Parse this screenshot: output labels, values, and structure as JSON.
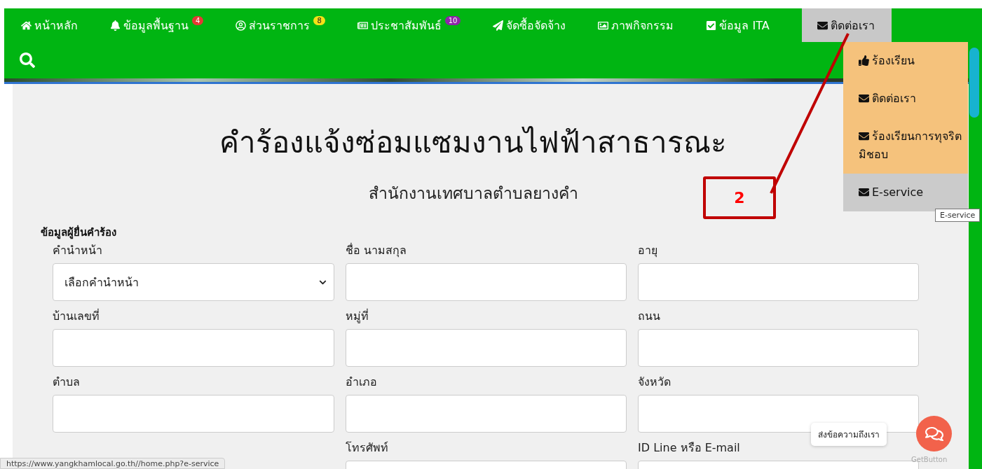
{
  "nav": {
    "items": [
      {
        "label": "หน้าหลัก",
        "expanded": false
      },
      {
        "label": "ข้อมูลพื้นฐาน",
        "expanded": false,
        "badge": {
          "text": "4",
          "color": "#e53935"
        }
      },
      {
        "label": "ส่วนราชการ",
        "expanded": false,
        "badge": {
          "text": "8",
          "color": "#f7e017"
        }
      },
      {
        "label": "ประชาสัมพันธ์",
        "expanded": false,
        "badge": {
          "text": "10",
          "color": "#8e24aa"
        }
      },
      {
        "label": "จัดซื้อจัดจ้าง",
        "expanded": false
      },
      {
        "label": "ภาพกิจกรรม",
        "expanded": false
      },
      {
        "label": "ข้อมูล ITA",
        "expanded": false
      },
      {
        "label": "ติดต่อเรา",
        "expanded": true
      }
    ]
  },
  "dropdown": {
    "items": [
      {
        "label": "ร้องเรียน",
        "selected": false
      },
      {
        "label": "ติดต่อเรา",
        "selected": false
      },
      {
        "label": "ร้องเรียนการทุจริต มิชอบ",
        "selected": false
      },
      {
        "label": "E-service",
        "selected": true
      }
    ],
    "tooltip": "E-service"
  },
  "form": {
    "title": "คำร้องแจ้งซ่อมแซมงานไฟฟ้าสาธารณะ",
    "subtitle": "สำนักงานเทศบาลตำบลยางคำ",
    "section": "ข้อมูลผู้ยื่นคำร้อง",
    "fields": [
      {
        "label": "คำนำหน้า",
        "kind": "select",
        "value": "เลือกคำนำหน้า"
      },
      {
        "label": "ชื่อ นามสกุล",
        "kind": "text"
      },
      {
        "label": "อายุ",
        "kind": "text"
      },
      {
        "label": "บ้านเลขที่",
        "kind": "text"
      },
      {
        "label": "หมู่ที่",
        "kind": "text"
      },
      {
        "label": "ถนน",
        "kind": "text"
      },
      {
        "label": "ตำบล",
        "kind": "text"
      },
      {
        "label": "อำเภอ",
        "kind": "text"
      },
      {
        "label": "จังหวัด",
        "kind": "text"
      },
      {
        "kind": "hidden"
      },
      {
        "label": "โทรศัพท์",
        "kind": "text"
      },
      {
        "label": "ID Line หรือ E-mail",
        "kind": "text"
      }
    ]
  },
  "annotation": {
    "text": "2"
  },
  "chat": {
    "bubble": "ส่งข้อความถึงเรา",
    "brand": "GetButton"
  },
  "status_bar": {
    "url": "https://www.yangkhamlocal.go.th//home.php?e-service"
  }
}
